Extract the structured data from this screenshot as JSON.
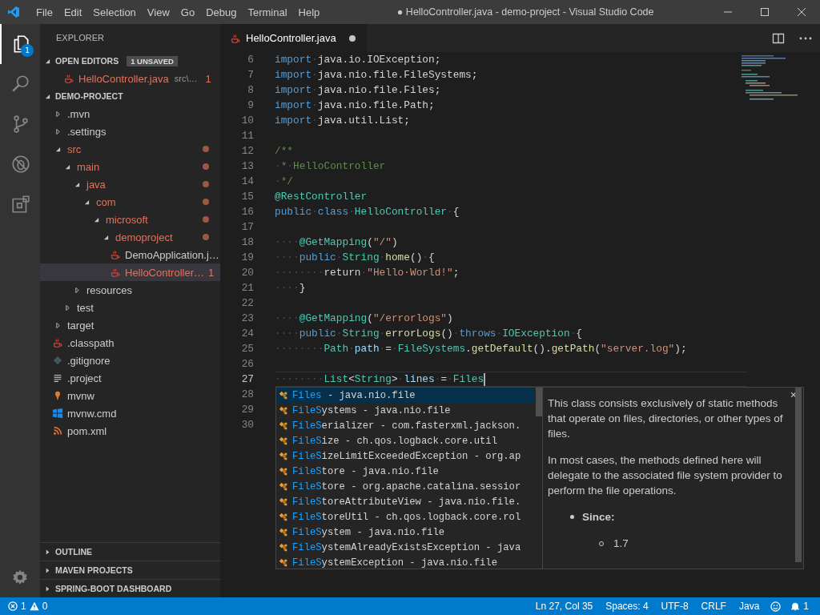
{
  "title_bar": {
    "menu": [
      "File",
      "Edit",
      "Selection",
      "View",
      "Go",
      "Debug",
      "Terminal",
      "Help"
    ],
    "title": "● HelloController.java - demo-project - Visual Studio Code"
  },
  "activity_bar": {
    "items": [
      {
        "kind": "explorer",
        "selected": true,
        "badge": "1"
      },
      {
        "kind": "search",
        "selected": false
      },
      {
        "kind": "source-control",
        "selected": false
      },
      {
        "kind": "debug",
        "selected": false
      },
      {
        "kind": "extensions",
        "selected": false
      }
    ]
  },
  "sidebar": {
    "title": "EXPLORER",
    "open_editors": {
      "label": "OPEN EDITORS",
      "badge": "1 UNSAVED",
      "expanded": true,
      "items": [
        {
          "name": "HelloController.java",
          "path": "src\\…",
          "problems": "1",
          "unsaved": true,
          "modified": true
        }
      ]
    },
    "project": {
      "label": "DEMO-PROJECT",
      "expanded": true,
      "tree": [
        {
          "name": ".mvn",
          "kind": "folder",
          "expanded": false,
          "modified": false,
          "selected": false
        },
        {
          "name": ".settings",
          "kind": "folder",
          "expanded": false,
          "modified": false,
          "selected": false
        },
        {
          "name": "src",
          "kind": "folder",
          "expanded": true,
          "modified": true,
          "selected": false,
          "children": [
            {
              "name": "main",
              "kind": "folder",
              "expanded": true,
              "modified": true,
              "selected": false,
              "children": [
                {
                  "name": "java",
                  "kind": "folder",
                  "expanded": true,
                  "modified": true,
                  "selected": false,
                  "children": [
                    {
                      "name": "com",
                      "kind": "folder",
                      "expanded": true,
                      "modified": true,
                      "selected": false,
                      "children": [
                        {
                          "name": "microsoft",
                          "kind": "folder",
                          "expanded": true,
                          "modified": true,
                          "selected": false,
                          "children": [
                            {
                              "name": "demoproject",
                              "kind": "folder",
                              "expanded": true,
                              "modified": true,
                              "selected": false,
                              "children": [
                                {
                                  "name": "DemoApplication.j…",
                                  "kind": "java",
                                  "modified": false,
                                  "selected": false
                                },
                                {
                                  "name": "HelloController…",
                                  "kind": "java",
                                  "modified": true,
                                  "selected": true,
                                  "problems": "1"
                                }
                              ]
                            }
                          ]
                        }
                      ]
                    }
                  ]
                },
                {
                  "name": "resources",
                  "kind": "folder",
                  "expanded": false,
                  "modified": false,
                  "selected": false
                }
              ]
            },
            {
              "name": "test",
              "kind": "folder",
              "expanded": false,
              "modified": false,
              "selected": false
            }
          ]
        },
        {
          "name": "target",
          "kind": "folder",
          "expanded": false,
          "modified": false,
          "selected": false
        },
        {
          "name": ".classpath",
          "kind": "java",
          "modified": false,
          "selected": false
        },
        {
          "name": ".gitignore",
          "kind": "git",
          "modified": false,
          "selected": false
        },
        {
          "name": ".project",
          "kind": "text",
          "modified": false,
          "selected": false
        },
        {
          "name": "mvnw",
          "kind": "pin",
          "modified": false,
          "selected": false
        },
        {
          "name": "mvnw.cmd",
          "kind": "windows",
          "modified": false,
          "selected": false
        },
        {
          "name": "pom.xml",
          "kind": "feed",
          "modified": false,
          "selected": false
        }
      ]
    },
    "sections": [
      {
        "label": "OUTLINE",
        "expanded": false
      },
      {
        "label": "MAVEN PROJECTS",
        "expanded": false
      },
      {
        "label": "SPRING-BOOT DASHBOARD",
        "expanded": false
      }
    ]
  },
  "editor": {
    "tabs": [
      {
        "name": "HelloController.java",
        "unsaved": true,
        "selected": true
      }
    ],
    "lines": [
      {
        "number": "6",
        "current": false,
        "tokens": [
          {
            "kind": "keyword",
            "text": "import"
          },
          {
            "kind": "whitespace",
            "text": "·"
          },
          {
            "kind": "plain",
            "text": "java.io.IOException;"
          }
        ]
      },
      {
        "number": "7",
        "current": false,
        "tokens": [
          {
            "kind": "keyword",
            "text": "import"
          },
          {
            "kind": "whitespace",
            "text": "·"
          },
          {
            "kind": "plain",
            "text": "java.nio.file.FileSystems;"
          }
        ]
      },
      {
        "number": "8",
        "current": false,
        "tokens": [
          {
            "kind": "keyword",
            "text": "import"
          },
          {
            "kind": "whitespace",
            "text": "·"
          },
          {
            "kind": "plain",
            "text": "java.nio.file.Files;"
          }
        ]
      },
      {
        "number": "9",
        "current": false,
        "tokens": [
          {
            "kind": "keyword",
            "text": "import"
          },
          {
            "kind": "whitespace",
            "text": "·"
          },
          {
            "kind": "plain",
            "text": "java.nio.file.Path;"
          }
        ]
      },
      {
        "number": "10",
        "current": false,
        "tokens": [
          {
            "kind": "keyword",
            "text": "import"
          },
          {
            "kind": "whitespace",
            "text": "·"
          },
          {
            "kind": "plain",
            "text": "java.util.List;"
          }
        ]
      },
      {
        "number": "11",
        "current": false
      },
      {
        "number": "12",
        "current": false,
        "tokens": [
          {
            "kind": "comment",
            "text": "/**"
          }
        ]
      },
      {
        "number": "13",
        "current": false,
        "tokens": [
          {
            "kind": "whitespace",
            "text": "·"
          },
          {
            "kind": "comment",
            "text": "*"
          },
          {
            "kind": "whitespace",
            "text": "·"
          },
          {
            "kind": "comment",
            "text": "HelloController"
          }
        ]
      },
      {
        "number": "14",
        "current": false,
        "tokens": [
          {
            "kind": "whitespace",
            "text": "·"
          },
          {
            "kind": "comment",
            "text": "*/"
          }
        ]
      },
      {
        "number": "15",
        "current": false,
        "tokens": [
          {
            "kind": "annotation",
            "text": "@RestController"
          }
        ]
      },
      {
        "number": "16",
        "current": false,
        "tokens": [
          {
            "kind": "keyword",
            "text": "public"
          },
          {
            "kind": "whitespace",
            "text": "·"
          },
          {
            "kind": "keyword",
            "text": "class"
          },
          {
            "kind": "whitespace",
            "text": "·"
          },
          {
            "kind": "type",
            "text": "HelloController"
          },
          {
            "kind": "whitespace",
            "text": "·"
          },
          {
            "kind": "plain",
            "text": "{"
          }
        ]
      },
      {
        "number": "17",
        "current": false
      },
      {
        "number": "18",
        "current": false,
        "tokens": [
          {
            "kind": "whitespace",
            "text": "····"
          },
          {
            "kind": "annotation",
            "text": "@GetMapping"
          },
          {
            "kind": "plain",
            "text": "("
          },
          {
            "kind": "string",
            "text": "\"/\""
          },
          {
            "kind": "plain",
            "text": ")"
          }
        ]
      },
      {
        "number": "19",
        "current": false,
        "tokens": [
          {
            "kind": "whitespace",
            "text": "····"
          },
          {
            "kind": "keyword",
            "text": "public"
          },
          {
            "kind": "whitespace",
            "text": "·"
          },
          {
            "kind": "type",
            "text": "String"
          },
          {
            "kind": "whitespace",
            "text": "·"
          },
          {
            "kind": "function",
            "text": "home"
          },
          {
            "kind": "plain",
            "text": "()"
          },
          {
            "kind": "whitespace",
            "text": "·"
          },
          {
            "kind": "plain",
            "text": "{"
          }
        ]
      },
      {
        "number": "20",
        "current": false,
        "tokens": [
          {
            "kind": "whitespace",
            "text": "········"
          },
          {
            "kind": "plain",
            "text": "return"
          },
          {
            "kind": "whitespace",
            "text": "·"
          },
          {
            "kind": "string",
            "text": "\"Hello·World!\""
          },
          {
            "kind": "plain",
            "text": ";"
          }
        ]
      },
      {
        "number": "21",
        "current": false,
        "tokens": [
          {
            "kind": "whitespace",
            "text": "····"
          },
          {
            "kind": "plain",
            "text": "}"
          }
        ]
      },
      {
        "number": "22",
        "current": false
      },
      {
        "number": "23",
        "current": false,
        "tokens": [
          {
            "kind": "whitespace",
            "text": "····"
          },
          {
            "kind": "annotation",
            "text": "@GetMapping"
          },
          {
            "kind": "plain",
            "text": "("
          },
          {
            "kind": "string",
            "text": "\"/errorlogs\""
          },
          {
            "kind": "plain",
            "text": ")"
          }
        ]
      },
      {
        "number": "24",
        "current": false,
        "tokens": [
          {
            "kind": "whitespace",
            "text": "····"
          },
          {
            "kind": "keyword",
            "text": "public"
          },
          {
            "kind": "whitespace",
            "text": "·"
          },
          {
            "kind": "type",
            "text": "String"
          },
          {
            "kind": "whitespace",
            "text": "·"
          },
          {
            "kind": "function",
            "text": "errorLogs"
          },
          {
            "kind": "plain",
            "text": "()"
          },
          {
            "kind": "whitespace",
            "text": "·"
          },
          {
            "kind": "keyword",
            "text": "throws"
          },
          {
            "kind": "whitespace",
            "text": "·"
          },
          {
            "kind": "type",
            "text": "IOException"
          },
          {
            "kind": "whitespace",
            "text": "·"
          },
          {
            "kind": "plain",
            "text": "{"
          }
        ]
      },
      {
        "number": "25",
        "current": false,
        "tokens": [
          {
            "kind": "whitespace",
            "text": "········"
          },
          {
            "kind": "type",
            "text": "Path"
          },
          {
            "kind": "whitespace",
            "text": "·"
          },
          {
            "kind": "variable",
            "text": "path"
          },
          {
            "kind": "whitespace",
            "text": "·"
          },
          {
            "kind": "plain",
            "text": "="
          },
          {
            "kind": "whitespace",
            "text": "·"
          },
          {
            "kind": "type",
            "text": "FileSystems"
          },
          {
            "kind": "plain",
            "text": "."
          },
          {
            "kind": "function",
            "text": "getDefault"
          },
          {
            "kind": "plain",
            "text": "()."
          },
          {
            "kind": "function",
            "text": "getPath"
          },
          {
            "kind": "plain",
            "text": "("
          },
          {
            "kind": "string",
            "text": "\"server.log\""
          },
          {
            "kind": "plain",
            "text": ");"
          }
        ]
      },
      {
        "number": "26",
        "current": false
      },
      {
        "number": "27",
        "current": true,
        "tokens": [
          {
            "kind": "whitespace",
            "text": "········"
          },
          {
            "kind": "type",
            "text": "List"
          },
          {
            "kind": "plain",
            "text": "<"
          },
          {
            "kind": "type",
            "text": "String"
          },
          {
            "kind": "plain",
            "text": ">"
          },
          {
            "kind": "whitespace",
            "text": "·"
          },
          {
            "kind": "variable",
            "text": "lines"
          },
          {
            "kind": "whitespace",
            "text": "·"
          },
          {
            "kind": "plain",
            "text": "="
          },
          {
            "kind": "whitespace",
            "text": "·"
          },
          {
            "kind": "type",
            "text": "Files"
          }
        ]
      },
      {
        "number": "28",
        "current": false
      },
      {
        "number": "29",
        "current": false
      },
      {
        "number": "30",
        "current": false
      }
    ]
  },
  "suggest": {
    "items": [
      {
        "match": "Files",
        "rest": " - java.nio.file",
        "selected": true
      },
      {
        "match": "FileS",
        "rest": "ystems - java.nio.file",
        "selected": false
      },
      {
        "match": "FileS",
        "rest": "erializer - com.fasterxml.jackson.",
        "selected": false
      },
      {
        "match": "FileS",
        "rest": "ize - ch.qos.logback.core.util",
        "selected": false
      },
      {
        "match": "FileS",
        "rest": "izeLimitExceededException - org.ap",
        "selected": false
      },
      {
        "match": "FileS",
        "rest": "tore - java.nio.file",
        "selected": false
      },
      {
        "match": "FileS",
        "rest": "tore - org.apache.catalina.sessior",
        "selected": false
      },
      {
        "match": "FileS",
        "rest": "toreAttributeView - java.nio.file.",
        "selected": false
      },
      {
        "match": "FileS",
        "rest": "toreUtil - ch.qos.logback.core.rol",
        "selected": false
      },
      {
        "match": "FileS",
        "rest": "ystem - java.nio.file",
        "selected": false
      },
      {
        "match": "FileS",
        "rest": "ystemAlreadyExistsException - java",
        "selected": false
      },
      {
        "match": "FileS",
        "rest": "ystemException - java.nio.file",
        "selected": false
      }
    ],
    "doc": {
      "close": "×",
      "paragraphs": [
        "This class consists exclusively of static methods that operate on files, directories, or other types of files.",
        "In most cases, the methods defined here will delegate to the associated file system provider to perform the file operations."
      ],
      "since_label": "Since:",
      "since_value": "1.7"
    }
  },
  "status_bar": {
    "errors": "1",
    "warnings": "0",
    "items": [
      "Ln 27, Col 35",
      "Spaces: 4",
      "UTF-8",
      "CRLF",
      "Java"
    ],
    "notifications": "1"
  }
}
